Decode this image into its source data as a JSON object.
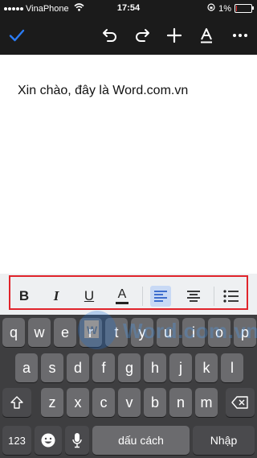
{
  "status_bar": {
    "carrier": "VinaPhone",
    "time": "17:54",
    "battery": "1%",
    "battery_level_percent": 1
  },
  "toolbar": {
    "icons": [
      "check-icon",
      "undo-icon",
      "redo-icon",
      "plus-icon",
      "text-format-icon",
      "more-icon"
    ],
    "accent_color": "#2b7cf6"
  },
  "document": {
    "text": "Xin chào, đây là Word.com.vn"
  },
  "format_bar": {
    "bold": "B",
    "italic": "I",
    "underline": "U",
    "font_color": "A",
    "active_alignment": "align-left"
  },
  "keyboard": {
    "row1": [
      "q",
      "w",
      "e",
      "r",
      "t",
      "y",
      "u",
      "i",
      "o",
      "p"
    ],
    "row2": [
      "a",
      "s",
      "d",
      "f",
      "g",
      "h",
      "j",
      "k",
      "l"
    ],
    "row3": [
      "z",
      "x",
      "c",
      "v",
      "b",
      "n",
      "m"
    ],
    "numbers_key": "123",
    "space_key": "dấu cách",
    "return_key": "Nhập"
  },
  "watermark": {
    "text": "Word.com.vn"
  }
}
